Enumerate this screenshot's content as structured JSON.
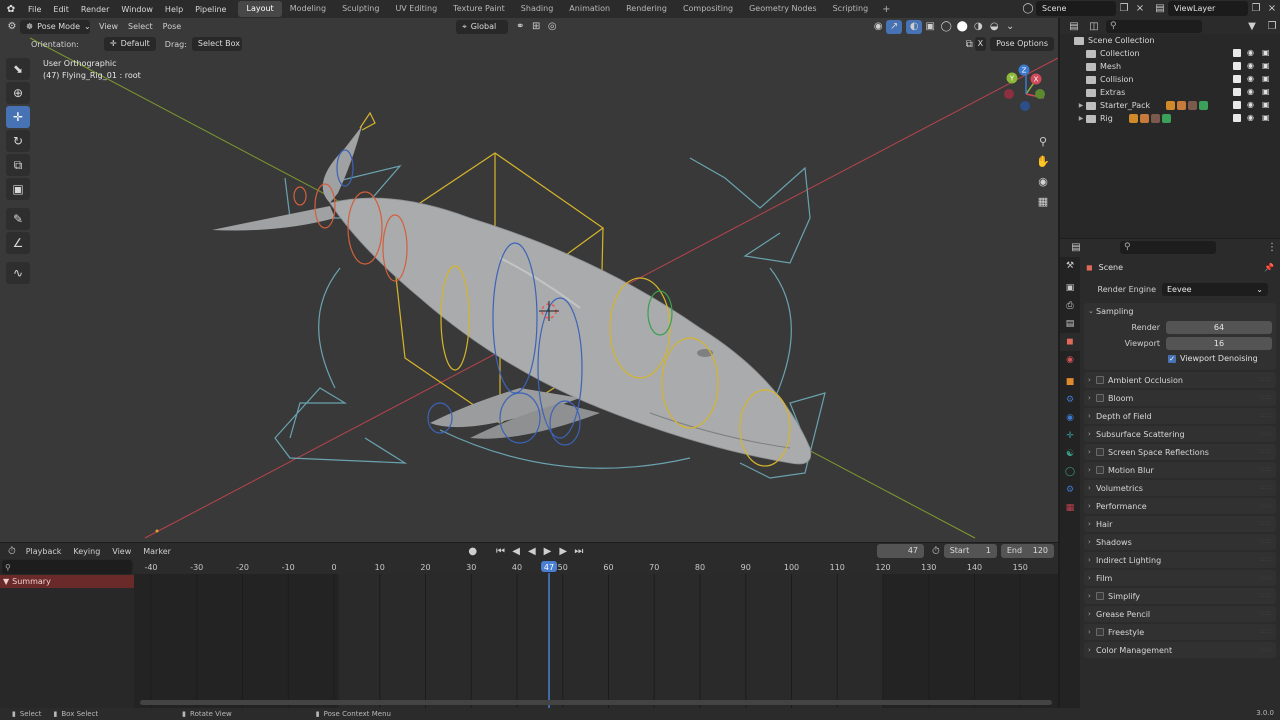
{
  "menubar": {
    "menus": [
      "File",
      "Edit",
      "Render",
      "Window",
      "Help",
      "Pipeline"
    ],
    "workspaces": [
      "Layout",
      "Modeling",
      "Sculpting",
      "UV Editing",
      "Texture Paint",
      "Shading",
      "Animation",
      "Rendering",
      "Compositing",
      "Geometry Nodes",
      "Scripting"
    ],
    "active_workspace": "Layout",
    "scene": "Scene",
    "view_layer": "ViewLayer"
  },
  "viewport": {
    "mode": "Pose Mode",
    "menus": [
      "View",
      "Select",
      "Pose"
    ],
    "transform_orientation": "Global",
    "orientation_label": "Orientation:",
    "orientation_value": "Default",
    "drag_label": "Drag:",
    "drag_value": "Select Box",
    "pose_options": "Pose Options",
    "x_axis_toggle": "X",
    "overlay_line1": "User Orthographic",
    "overlay_line2": "(47) Flying_Rig_01 : root",
    "gizmo_axes": [
      "X",
      "Y",
      "Z"
    ]
  },
  "timeline": {
    "menus": [
      "Playback",
      "Keying",
      "View",
      "Marker"
    ],
    "current_frame": "47",
    "start_label": "Start",
    "start_value": "1",
    "end_label": "End",
    "end_value": "120",
    "summary": "Summary",
    "ruler": [
      "-40",
      "-30",
      "-20",
      "-10",
      "0",
      "10",
      "20",
      "30",
      "40",
      "50",
      "60",
      "70",
      "80",
      "90",
      "100",
      "110",
      "120",
      "130",
      "140",
      "150"
    ]
  },
  "statusbar": {
    "items": [
      "Select",
      "Box Select",
      "Rotate View",
      "Pose Context Menu"
    ],
    "version": "3.0.0"
  },
  "outliner": {
    "root": "Scene Collection",
    "rows": [
      {
        "label": "Collection",
        "expandable": false
      },
      {
        "label": "Mesh",
        "expandable": false
      },
      {
        "label": "Collision",
        "expandable": false
      },
      {
        "label": "Extras",
        "expandable": false
      },
      {
        "label": "Starter_Pack",
        "expandable": true
      },
      {
        "label": "Rig",
        "expandable": true
      }
    ]
  },
  "properties": {
    "context": "Scene",
    "render_engine_label": "Render Engine",
    "render_engine": "Eevee",
    "sampling": {
      "title": "Sampling",
      "render_label": "Render",
      "render_value": "64",
      "viewport_label": "Viewport",
      "viewport_value": "16",
      "denoise_label": "Viewport Denoising"
    },
    "panels": [
      {
        "label": "Ambient Occlusion",
        "checkbox": true
      },
      {
        "label": "Bloom",
        "checkbox": true
      },
      {
        "label": "Depth of Field",
        "checkbox": false
      },
      {
        "label": "Subsurface Scattering",
        "checkbox": false
      },
      {
        "label": "Screen Space Reflections",
        "checkbox": true
      },
      {
        "label": "Motion Blur",
        "checkbox": true
      },
      {
        "label": "Volumetrics",
        "checkbox": false
      },
      {
        "label": "Performance",
        "checkbox": false
      },
      {
        "label": "Hair",
        "checkbox": false
      },
      {
        "label": "Shadows",
        "checkbox": false
      },
      {
        "label": "Indirect Lighting",
        "checkbox": false
      },
      {
        "label": "Film",
        "checkbox": false
      },
      {
        "label": "Simplify",
        "checkbox": true
      },
      {
        "label": "Grease Pencil",
        "checkbox": false
      },
      {
        "label": "Freestyle",
        "checkbox": true
      },
      {
        "label": "Color Management",
        "checkbox": false
      }
    ]
  }
}
